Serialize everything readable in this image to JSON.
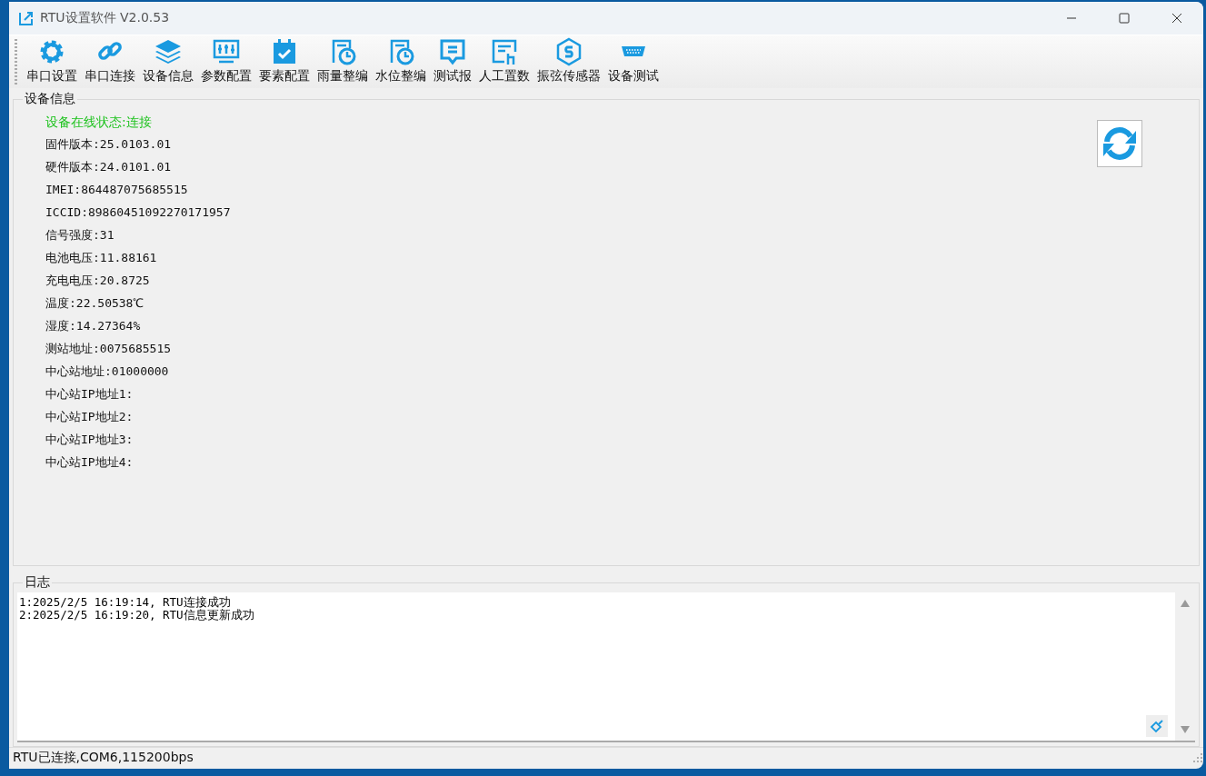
{
  "window": {
    "title": "RTU设置软件 V2.0.53"
  },
  "toolbar": [
    {
      "label": "串口设置"
    },
    {
      "label": "串口连接"
    },
    {
      "label": "设备信息"
    },
    {
      "label": "参数配置"
    },
    {
      "label": "要素配置"
    },
    {
      "label": "雨量整编"
    },
    {
      "label": "水位整编"
    },
    {
      "label": "测试报"
    },
    {
      "label": "人工置数"
    },
    {
      "label": "振弦传感器"
    },
    {
      "label": "设备测试"
    }
  ],
  "device_info": {
    "title": "设备信息",
    "lines": [
      {
        "kind": "status",
        "text": "设备在线状态:连接"
      },
      {
        "kind": "field",
        "text": "固件版本:25.0103.01"
      },
      {
        "kind": "field",
        "text": "硬件版本:24.0101.01"
      },
      {
        "kind": "field",
        "text": "IMEI:864487075685515"
      },
      {
        "kind": "field",
        "text": "ICCID:89860451092270171957"
      },
      {
        "kind": "field",
        "text": "信号强度:31"
      },
      {
        "kind": "field",
        "text": "电池电压:11.88161"
      },
      {
        "kind": "field",
        "text": "充电电压:20.8725"
      },
      {
        "kind": "field",
        "text": "温度:22.50538℃"
      },
      {
        "kind": "field",
        "text": "湿度:14.27364%"
      },
      {
        "kind": "field",
        "text": "测站地址:0075685515"
      },
      {
        "kind": "field",
        "text": "中心站地址:01000000"
      },
      {
        "kind": "field",
        "text": "中心站IP地址1:"
      },
      {
        "kind": "field",
        "text": "中心站IP地址2:"
      },
      {
        "kind": "field",
        "text": "中心站IP地址3:"
      },
      {
        "kind": "field",
        "text": "中心站IP地址4:"
      }
    ]
  },
  "log": {
    "title": "日志",
    "lines": [
      "1:2025/2/5 16:19:14, RTU连接成功",
      "2:2025/2/5 16:19:20, RTU信息更新成功"
    ]
  },
  "status_bar": {
    "text": "RTU已连接,COM6,115200bps"
  }
}
